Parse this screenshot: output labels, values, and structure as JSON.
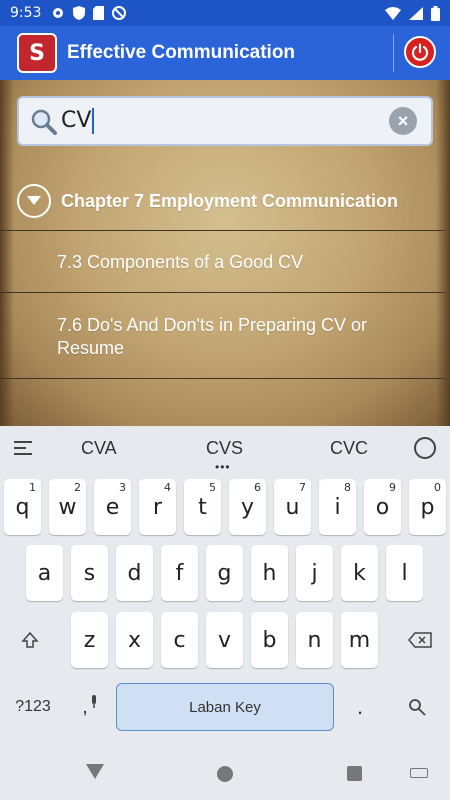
{
  "status_bar": {
    "time": "9:53"
  },
  "app_bar": {
    "title": "Effective Communication",
    "logo_text": "S"
  },
  "search": {
    "value": "CV"
  },
  "chapter": {
    "label": "Chapter 7 Employment Communication"
  },
  "results": [
    {
      "label": "7.3 Components of a Good CV"
    },
    {
      "label": "7.6 Do's And Don'ts in Preparing CV or Resume"
    }
  ],
  "keyboard": {
    "suggestions": [
      "CVA",
      "CVS",
      "CVC"
    ],
    "row1": [
      {
        "k": "q",
        "n": "1"
      },
      {
        "k": "w",
        "n": "2"
      },
      {
        "k": "e",
        "n": "3"
      },
      {
        "k": "r",
        "n": "4"
      },
      {
        "k": "t",
        "n": "5"
      },
      {
        "k": "y",
        "n": "6"
      },
      {
        "k": "u",
        "n": "7"
      },
      {
        "k": "i",
        "n": "8"
      },
      {
        "k": "o",
        "n": "9"
      },
      {
        "k": "p",
        "n": "0"
      }
    ],
    "row2": [
      "a",
      "s",
      "d",
      "f",
      "g",
      "h",
      "j",
      "k",
      "l"
    ],
    "row3": [
      "z",
      "x",
      "c",
      "v",
      "b",
      "n",
      "m"
    ],
    "symbols_label": "?123",
    "comma_label": ",",
    "space_label": "Laban Key",
    "period_label": "."
  },
  "colors": {
    "app_bar": "#2a64d8",
    "status_bar": "#1d55c7",
    "power": "#d91f1f",
    "space_key": "#cfe0f5"
  }
}
